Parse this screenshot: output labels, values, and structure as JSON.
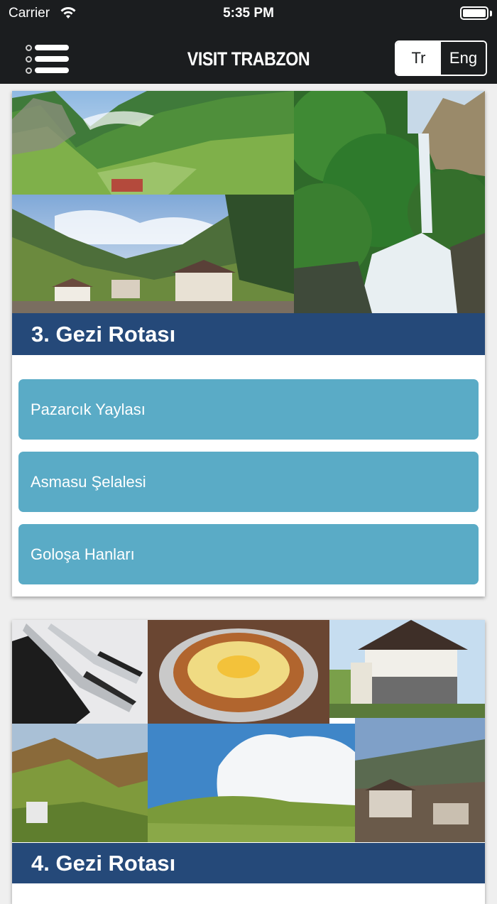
{
  "status_bar": {
    "carrier": "Carrier",
    "time": "5:35 PM"
  },
  "nav": {
    "title": "VISIT TRABZON",
    "lang_tr": "Tr",
    "lang_eng": "Eng",
    "active_lang": "Tr"
  },
  "colors": {
    "navbar": "#1b1d1f",
    "route_banner": "#123a6e",
    "place_button": "#5aabc6"
  },
  "routes": [
    {
      "title": "3. Gezi Rotası",
      "places": [
        "Pazarcık Yaylası",
        "Asmasu Şelalesi",
        "Goloşa Hanları"
      ]
    },
    {
      "title": "4. Gezi Rotası",
      "places": []
    }
  ]
}
